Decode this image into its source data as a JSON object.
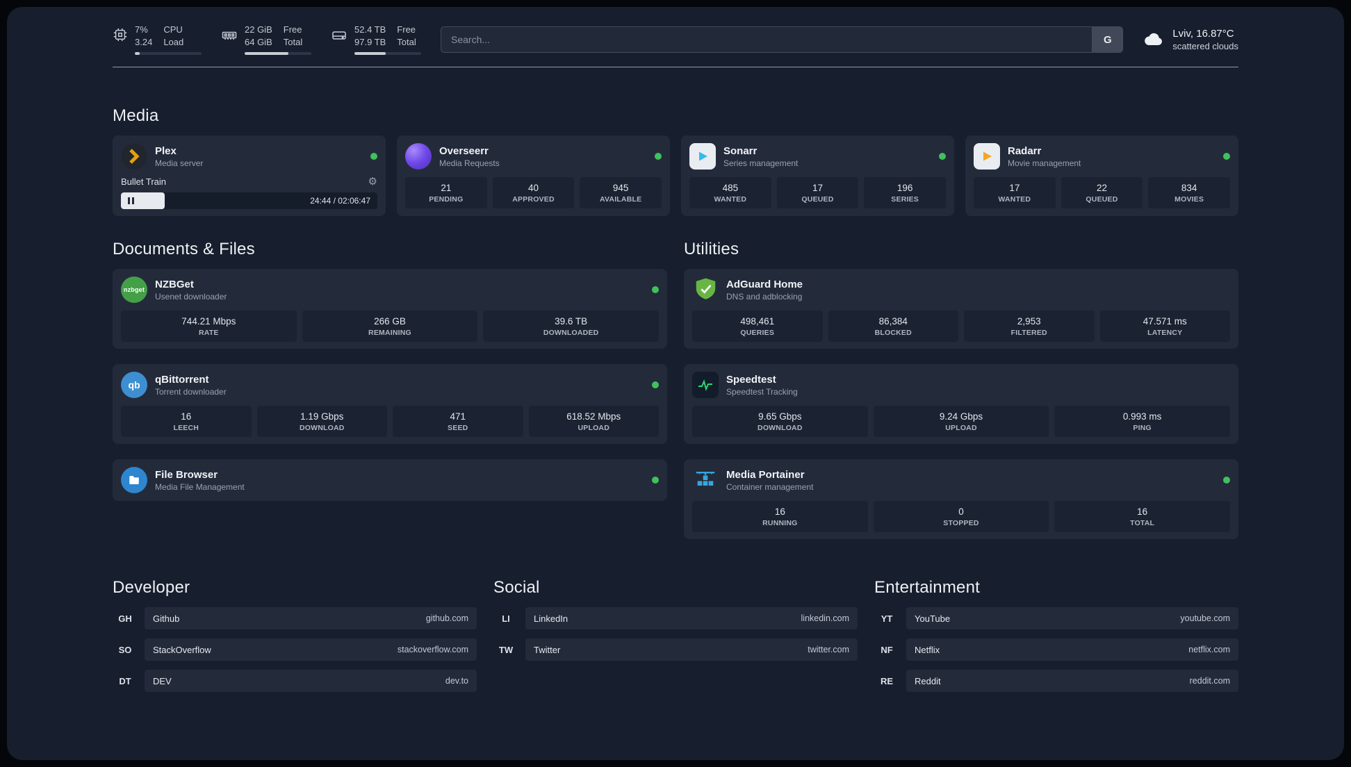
{
  "icons": {
    "gear": "⚙",
    "nzbget_text": "nzbget",
    "qbittorrent_text": "qb"
  },
  "topbar": {
    "metrics": [
      {
        "name": "cpu",
        "value_top": "7%",
        "value_bottom": "3.24",
        "label_top": "CPU",
        "label_bottom": "Load",
        "bar_style": "width:7%"
      },
      {
        "name": "memory",
        "value_top": "22 GiB",
        "value_bottom": "64 GiB",
        "label_top": "Free",
        "label_bottom": "Total",
        "bar_style": "width:66%"
      },
      {
        "name": "storage",
        "value_top": "52.4 TB",
        "value_bottom": "97.9 TB",
        "label_top": "Free",
        "label_bottom": "Total",
        "bar_style": "width:47%"
      }
    ],
    "search": {
      "placeholder": "Search...",
      "engine_button": "G"
    },
    "weather": {
      "location": "Lviv, 16.87°C",
      "condition": "scattered clouds"
    }
  },
  "media": {
    "heading": "Media",
    "plex": {
      "name": "Plex",
      "subtitle": "Media server",
      "now_playing": "Bullet Train",
      "time": "24:44 / 02:06:47",
      "progress_style": "width:17%"
    },
    "overseerr": {
      "name": "Overseerr",
      "subtitle": "Media Requests",
      "stats": [
        {
          "value": "21",
          "label": "PENDING"
        },
        {
          "value": "40",
          "label": "APPROVED"
        },
        {
          "value": "945",
          "label": "AVAILABLE"
        }
      ]
    },
    "sonarr": {
      "name": "Sonarr",
      "subtitle": "Series management",
      "stats": [
        {
          "value": "485",
          "label": "WANTED"
        },
        {
          "value": "17",
          "label": "QUEUED"
        },
        {
          "value": "196",
          "label": "SERIES"
        }
      ]
    },
    "radarr": {
      "name": "Radarr",
      "subtitle": "Movie management",
      "stats": [
        {
          "value": "17",
          "label": "WANTED"
        },
        {
          "value": "22",
          "label": "QUEUED"
        },
        {
          "value": "834",
          "label": "MOVIES"
        }
      ]
    }
  },
  "documents": {
    "heading": "Documents & Files",
    "nzbget": {
      "name": "NZBGet",
      "subtitle": "Usenet downloader",
      "stats": [
        {
          "value": "744.21 Mbps",
          "label": "RATE"
        },
        {
          "value": "266 GB",
          "label": "REMAINING"
        },
        {
          "value": "39.6 TB",
          "label": "DOWNLOADED"
        }
      ]
    },
    "qbittorrent": {
      "name": "qBittorrent",
      "subtitle": "Torrent downloader",
      "stats": [
        {
          "value": "16",
          "label": "LEECH"
        },
        {
          "value": "1.19 Gbps",
          "label": "DOWNLOAD"
        },
        {
          "value": "471",
          "label": "SEED"
        },
        {
          "value": "618.52 Mbps",
          "label": "UPLOAD"
        }
      ]
    },
    "filebrowser": {
      "name": "File Browser",
      "subtitle": "Media File Management"
    }
  },
  "utilities": {
    "heading": "Utilities",
    "adguard": {
      "name": "AdGuard Home",
      "subtitle": "DNS and adblocking",
      "stats": [
        {
          "value": "498,461",
          "label": "QUERIES"
        },
        {
          "value": "86,384",
          "label": "BLOCKED"
        },
        {
          "value": "2,953",
          "label": "FILTERED"
        },
        {
          "value": "47.571 ms",
          "label": "LATENCY"
        }
      ]
    },
    "speedtest": {
      "name": "Speedtest",
      "subtitle": "Speedtest Tracking",
      "stats": [
        {
          "value": "9.65 Gbps",
          "label": "DOWNLOAD"
        },
        {
          "value": "9.24 Gbps",
          "label": "UPLOAD"
        },
        {
          "value": "0.993 ms",
          "label": "PING"
        }
      ]
    },
    "portainer": {
      "name": "Media Portainer",
      "subtitle": "Container management",
      "stats": [
        {
          "value": "16",
          "label": "RUNNING"
        },
        {
          "value": "0",
          "label": "STOPPED"
        },
        {
          "value": "16",
          "label": "TOTAL"
        }
      ]
    }
  },
  "bookmarks": [
    {
      "heading": "Developer",
      "items": [
        {
          "abbr": "GH",
          "name": "Github",
          "url": "github.com"
        },
        {
          "abbr": "SO",
          "name": "StackOverflow",
          "url": "stackoverflow.com"
        },
        {
          "abbr": "DT",
          "name": "DEV",
          "url": "dev.to"
        }
      ]
    },
    {
      "heading": "Social",
      "items": [
        {
          "abbr": "LI",
          "name": "LinkedIn",
          "url": "linkedin.com"
        },
        {
          "abbr": "TW",
          "name": "Twitter",
          "url": "twitter.com"
        }
      ]
    },
    {
      "heading": "Entertainment",
      "items": [
        {
          "abbr": "YT",
          "name": "YouTube",
          "url": "youtube.com"
        },
        {
          "abbr": "NF",
          "name": "Netflix",
          "url": "netflix.com"
        },
        {
          "abbr": "RE",
          "name": "Reddit",
          "url": "reddit.com"
        }
      ]
    }
  ],
  "colors": {
    "status_online": "#41c05c",
    "panel_bg": "#171e2d",
    "card_bg": "#232b3b",
    "tile_bg": "#1b2332",
    "plex_accent": "#e5a00d",
    "sonarr_accent": "#35b8f1",
    "radarr_accent": "#f5a623",
    "adguard_green": "#68b544",
    "speedtest_green": "#2bd96f",
    "portainer_blue": "#37a5dd"
  }
}
